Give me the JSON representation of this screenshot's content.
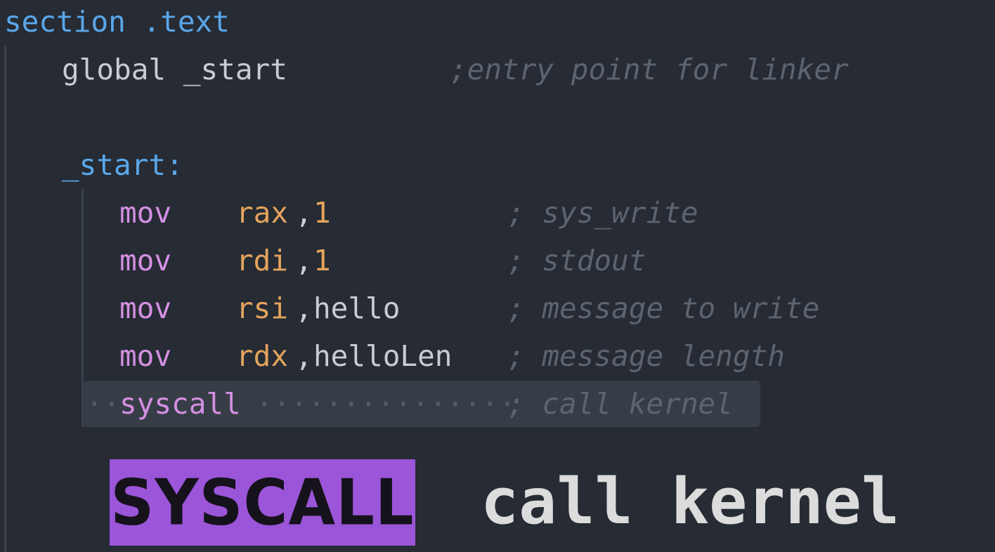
{
  "code": {
    "section_line": "section .text",
    "global_keyword": "global _start",
    "global_comment": ";entry point for linker",
    "label": "_start:",
    "lines": [
      {
        "instr": "mov",
        "reg": "rax",
        "arg": "1",
        "comment": "; sys_write"
      },
      {
        "instr": "mov",
        "reg": "rdi",
        "arg": "1",
        "comment": "; stdout"
      },
      {
        "instr": "mov",
        "reg": "rsi",
        "arg": "hello",
        "comment": "; message to write"
      },
      {
        "instr": "mov",
        "reg": "rdx",
        "arg": "helloLen",
        "comment": "; message length"
      }
    ],
    "syscall": {
      "instr": "syscall",
      "comment": "; call kernel"
    }
  },
  "banner": {
    "label": "SYSCALL",
    "caption": "call kernel",
    "accent_color": "#9b55d9"
  },
  "colors": {
    "background": "#262b34",
    "keyword": "#5aa7ea",
    "instruction": "#d48fe2",
    "register": "#e3a45d",
    "comment": "#5d6470"
  }
}
